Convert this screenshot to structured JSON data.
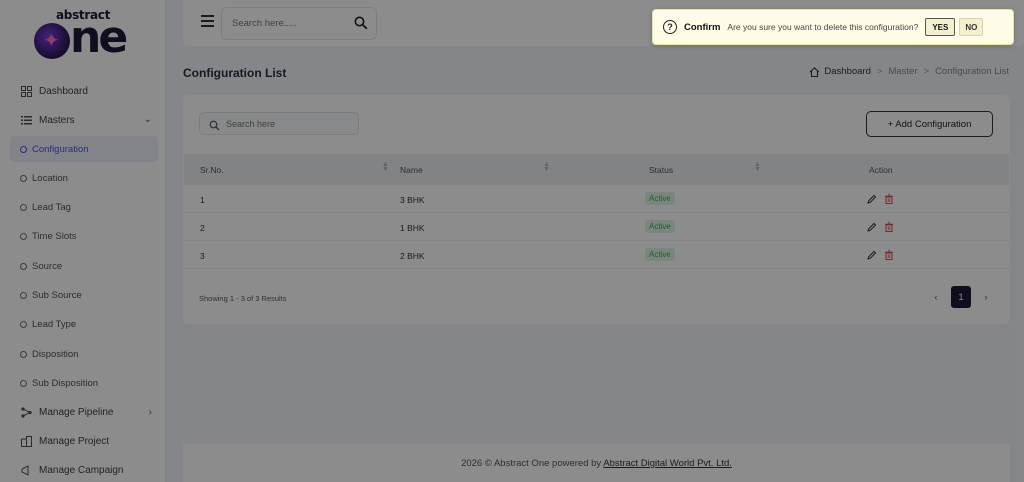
{
  "brand": {
    "tiny": "abstract",
    "big": "one"
  },
  "sidebar": {
    "items": [
      {
        "label": "Dashboard",
        "icon": "grid-icon"
      },
      {
        "label": "Masters",
        "icon": "list-icon"
      }
    ],
    "sub_items": [
      {
        "label": "Configuration"
      },
      {
        "label": "Location"
      },
      {
        "label": "Lead Tag"
      },
      {
        "label": "Time Slots"
      },
      {
        "label": "Source"
      },
      {
        "label": "Sub Source"
      },
      {
        "label": "Lead Type"
      },
      {
        "label": "Disposition"
      },
      {
        "label": "Sub Disposition"
      }
    ],
    "bottom_items": [
      {
        "label": "Manage Pipeline",
        "icon": "pipeline-icon"
      },
      {
        "label": "Manage Project",
        "icon": "building-icon"
      },
      {
        "label": "Manage Campaign",
        "icon": "megaphone-icon"
      }
    ]
  },
  "topbar": {
    "search_placeholder": "Search here....."
  },
  "page": {
    "title": "Configuration List",
    "breadcrumb": [
      "Dashboard",
      "Master",
      "Configuration List"
    ]
  },
  "card": {
    "search_placeholder": "Search here",
    "add_button": "+ Add Configuration",
    "columns": [
      "Sr.No.",
      "Name",
      "Status",
      "Action"
    ],
    "rows": [
      {
        "sr": "1",
        "name": "3 BHK",
        "status": "Active"
      },
      {
        "sr": "2",
        "name": "1 BHK",
        "status": "Active"
      },
      {
        "sr": "3",
        "name": "2 BHK",
        "status": "Active"
      }
    ],
    "showing": "Showing 1 - 3 of 3 Results",
    "pager": {
      "prev": "‹",
      "current": "1",
      "next": "›"
    }
  },
  "footer": {
    "text": "2026 © Abstract One powered by ",
    "link": "Abstract Digital World Pvt. Ltd."
  },
  "confirm": {
    "title": "Confirm",
    "message": "Are you sure you want to delete this configuration?",
    "yes": "YES",
    "no": "NO"
  },
  "colors": {
    "accent": "#4a57d6",
    "badge_bg": "#dff5e3",
    "badge_text": "#3ca456",
    "pager_active": "#1c1b3a",
    "confirm_bg": "#fffde7",
    "delete_icon": "#d9534f"
  }
}
